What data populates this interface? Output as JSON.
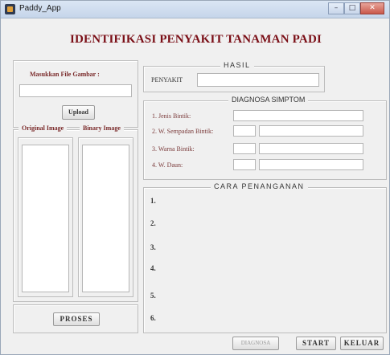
{
  "window": {
    "title": "Paddy_App",
    "minimize": "–",
    "maximize": "□",
    "close": "✕"
  },
  "main_title": "IDENTIFIKASI PENYAKIT TANAMAN PADI",
  "upload_panel": {
    "label": "Masukkan File Gambar :",
    "file_value": "",
    "upload_button": "Upload"
  },
  "image_panel": {
    "original_label": "Original Image",
    "binary_label": "Binary Image"
  },
  "proses_button": "PROSES",
  "hasil": {
    "legend": "HASIL",
    "penyakit_label": "PENYAKIT",
    "penyakit_value": ""
  },
  "diagnosa": {
    "legend": "DIAGNOSA SIMPTOM",
    "rows": [
      {
        "label": "1. Jenis Bintik:"
      },
      {
        "label": "2. W. Sempadan Bintik:"
      },
      {
        "label": "3. Warna Bintik:"
      },
      {
        "label": "4. W. Daun:"
      }
    ]
  },
  "cara": {
    "legend": "CARA PENANGANAN",
    "items": [
      "1.",
      "2.",
      "3.",
      "4.",
      "5.",
      "6."
    ]
  },
  "buttons": {
    "diagnosa": "DIAGNOSA",
    "start": "START",
    "keluar": "KELUAR"
  },
  "colors": {
    "title_red": "#7a0e16",
    "background": "#f0f0f0"
  }
}
